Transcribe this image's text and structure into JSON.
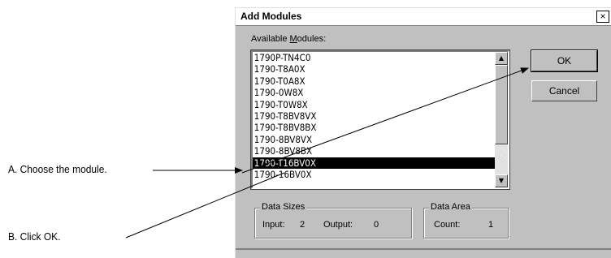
{
  "callouts": {
    "a": "A. Choose the module.",
    "b": "B. Click OK."
  },
  "dialog": {
    "title": "Add Modules",
    "close_glyph": "×",
    "available_label": "Available Modules:",
    "modules": [
      "1790P-TN4C0",
      "1790-T8A0X",
      "1790-T0A8X",
      "1790-0W8X",
      "1790-T0W8X",
      "1790-T8BV8VX",
      "1790-T8BV8BX",
      "1790-8BV8VX",
      "1790-8BV8BX",
      "1790-T16BV0X",
      "1790-16BV0X"
    ],
    "selected_module": "1790-T16BV0X",
    "ok_label": "OK",
    "cancel_label": "Cancel",
    "data_sizes": {
      "label": "Data Sizes",
      "input_label": "Input:",
      "input_value": "2",
      "output_label": "Output:",
      "output_value": "0"
    },
    "data_area": {
      "label": "Data Area",
      "count_label": "Count:",
      "count_value": "1"
    }
  },
  "icons": {
    "scroll_up": "up-arrow-icon",
    "scroll_down": "down-arrow-icon"
  }
}
